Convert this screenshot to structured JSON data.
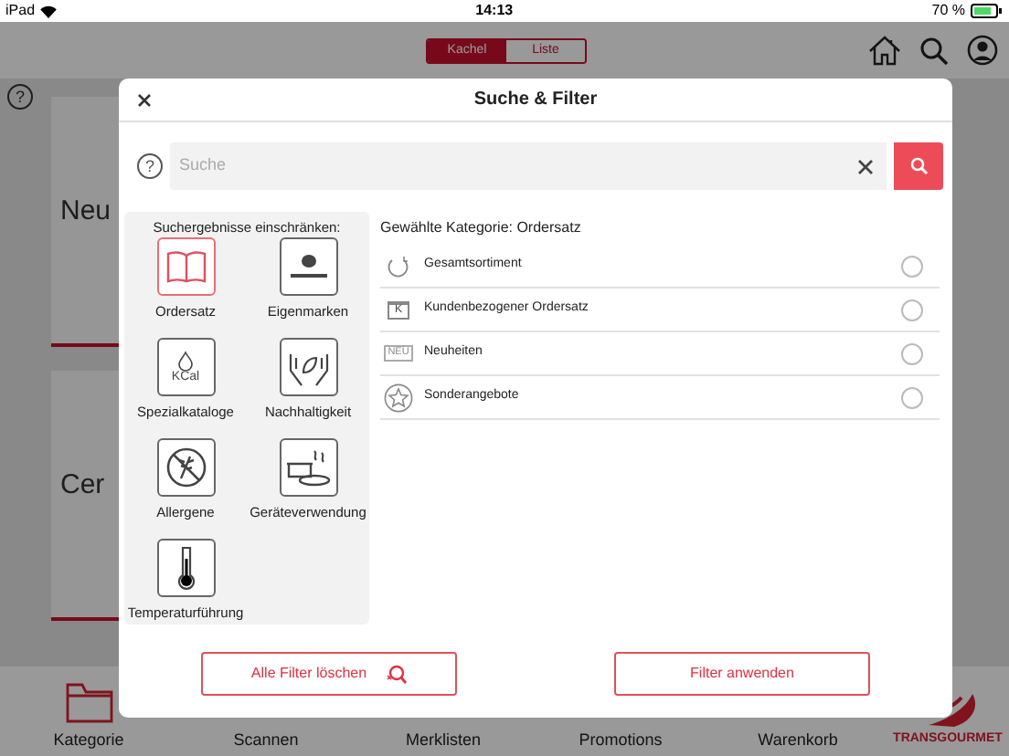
{
  "status_bar": {
    "device": "iPad",
    "time": "14:13",
    "battery": "70 %"
  },
  "view_toggle": [
    {
      "label": "Kachel",
      "selected": true
    },
    {
      "label": "Liste",
      "selected": false
    }
  ],
  "page_help": "?",
  "tiles": [
    {
      "title": "Neu"
    },
    {
      "title": "Cer"
    }
  ],
  "tab_bar": [
    {
      "label": "Kategorie",
      "selected": true
    },
    {
      "label": "Scannen",
      "selected": false
    },
    {
      "label": "Merklisten",
      "selected": false
    },
    {
      "label": "Promotions",
      "selected": false
    },
    {
      "label": "Warenkorb",
      "selected": false
    }
  ],
  "logo": "TRANSGOURMET",
  "dialog": {
    "title": "Suche & Filter",
    "help": "?",
    "search": {
      "placeholder": "Suche"
    },
    "filter_heading": "Suchergebnisse einschränken:",
    "categories": [
      {
        "label": "Ordersatz",
        "kind": "book",
        "selected": true
      },
      {
        "label": "Eigenmarken",
        "kind": "brand",
        "selected": false
      },
      {
        "label": "Spezialkataloge",
        "kind": "kcal",
        "icon_text": "KCal",
        "selected": false
      },
      {
        "label": "Nachhaltigkeit",
        "kind": "hands",
        "selected": false
      },
      {
        "label": "Allergene",
        "kind": "allergen",
        "selected": false
      },
      {
        "label": "Geräteverwendung",
        "kind": "cookware",
        "selected": false
      },
      {
        "label": "Temperaturführung",
        "kind": "thermometer",
        "selected": false
      }
    ],
    "selected_category": "Gewählte Kategorie: Ordersatz",
    "options": [
      {
        "label": "Gesamtsortiment",
        "kind": "refresh",
        "selected": false
      },
      {
        "label": "Kundenbezogener Ordersatz",
        "kind": "folder",
        "icon_text": "K",
        "selected": false
      },
      {
        "label": "Neuheiten",
        "kind": "new",
        "icon_text": "NEU",
        "selected": false
      },
      {
        "label": "Sonderangebote",
        "kind": "star",
        "selected": false
      }
    ],
    "buttons": [
      {
        "label": "Alle Filter löschen",
        "kind": "clear"
      },
      {
        "label": "Filter anwenden",
        "kind": "apply"
      }
    ]
  }
}
